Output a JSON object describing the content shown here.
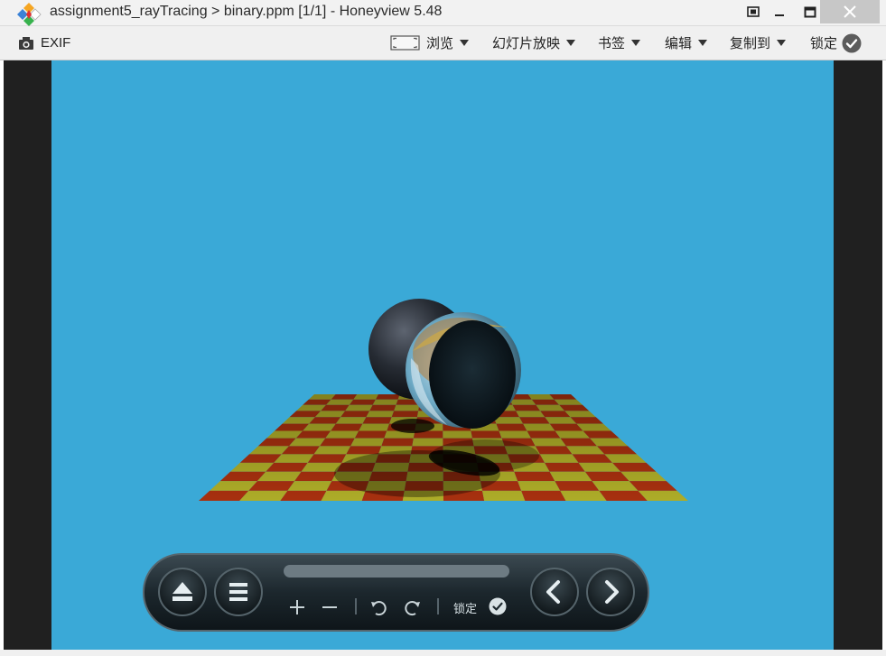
{
  "window": {
    "title": "assignment5_rayTracing > binary.ppm [1/1] - Honeyview 5.48"
  },
  "toolbar": {
    "exif_label": "EXIF",
    "browse_label": "浏览",
    "slideshow_label": "幻灯片放映",
    "bookmarks_label": "书签",
    "edit_label": "编辑",
    "copy_to_label": "复制到",
    "lock_label": "锁定"
  },
  "osd": {
    "lock_label": "锁定"
  },
  "icons": [
    "honeyview-logo-icon",
    "fullscreen-icon",
    "minimize-icon",
    "maximize-icon",
    "close-icon",
    "camera-icon",
    "browse-icon",
    "lock-check-icon",
    "eject-icon",
    "menu-icon",
    "zoom-in-icon",
    "zoom-out-icon",
    "rotate-left-icon",
    "rotate-right-icon",
    "previous-icon",
    "next-icon"
  ],
  "colors": {
    "background_sky": "#3aa9d7",
    "checker_red": "#a7300f",
    "checker_yellow": "#adac28",
    "viewer_frame": "#202020",
    "toolbar_bg": "#f0f0f0"
  }
}
